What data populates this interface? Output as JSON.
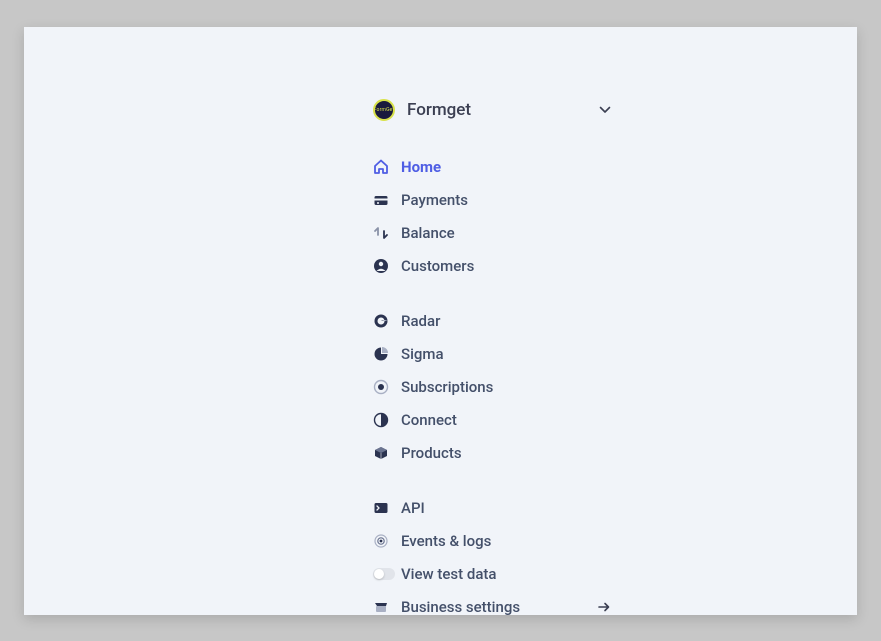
{
  "account": {
    "name": "Formget"
  },
  "groups": [
    {
      "items": [
        {
          "key": "home",
          "label": "Home",
          "active": true
        },
        {
          "key": "payments",
          "label": "Payments"
        },
        {
          "key": "balance",
          "label": "Balance"
        },
        {
          "key": "customers",
          "label": "Customers"
        }
      ]
    },
    {
      "items": [
        {
          "key": "radar",
          "label": "Radar"
        },
        {
          "key": "sigma",
          "label": "Sigma"
        },
        {
          "key": "subscriptions",
          "label": "Subscriptions"
        },
        {
          "key": "connect",
          "label": "Connect"
        },
        {
          "key": "products",
          "label": "Products"
        }
      ]
    },
    {
      "items": [
        {
          "key": "api",
          "label": "API"
        },
        {
          "key": "events",
          "label": "Events & logs"
        },
        {
          "key": "testdata",
          "label": "View test data"
        },
        {
          "key": "business",
          "label": "Business settings"
        }
      ]
    }
  ]
}
